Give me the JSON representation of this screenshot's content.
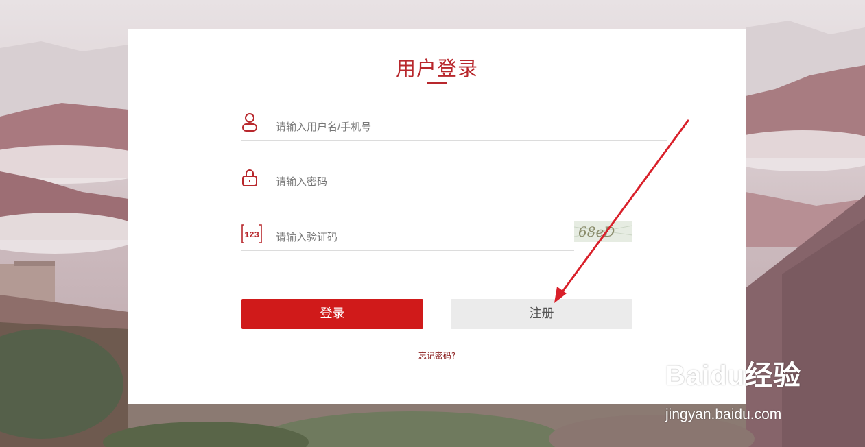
{
  "login": {
    "title": "用户登录",
    "username_placeholder": "请输入用户名/手机号",
    "password_placeholder": "请输入密码",
    "captcha_placeholder": "请输入验证码",
    "captcha_text": "68eD",
    "login_label": "登录",
    "register_label": "注册",
    "forgot_label": "忘记密码?"
  },
  "icons": {
    "username": "user-icon",
    "password": "lock-icon",
    "captcha": "number-123-icon"
  },
  "watermark": {
    "logo_text": "Baidu经验",
    "site": "jingyan.baidu.com"
  },
  "colors": {
    "accent": "#b8282d",
    "login_button": "#d01a1a",
    "register_button": "#ebebeb"
  }
}
